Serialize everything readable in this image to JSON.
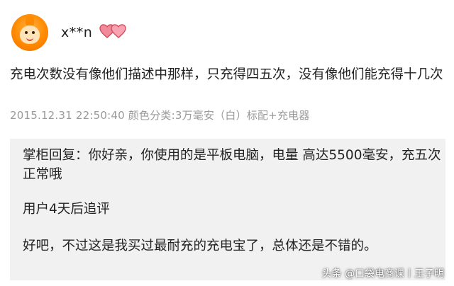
{
  "review": {
    "username": "x**n",
    "avatar_icon": "orange-cartoon-avatar",
    "badge_icon": "double-heart-icon",
    "content": "充电次数没有像他们描述中那样，只充得四五次，没有像他们能充得十几次",
    "meta": "2015.12.31 22:50:40 颜色分类:3万毫安（白）标配+充电器"
  },
  "reply": {
    "text": "掌柜回复：你好亲，你使用的是平板电脑，电量 高达5500毫安，充五次正常哦",
    "followup_label": "用户4天后追评",
    "followup_text": "好吧，不过这是我买过最耐充的充电宝了，总体还是不错的。"
  },
  "watermark": "头条 @口袋电商课丨王子明",
  "colors": {
    "meta_text": "#9a9a9a",
    "reply_background": "#f1f1f1",
    "heart": "#e05a6a"
  }
}
